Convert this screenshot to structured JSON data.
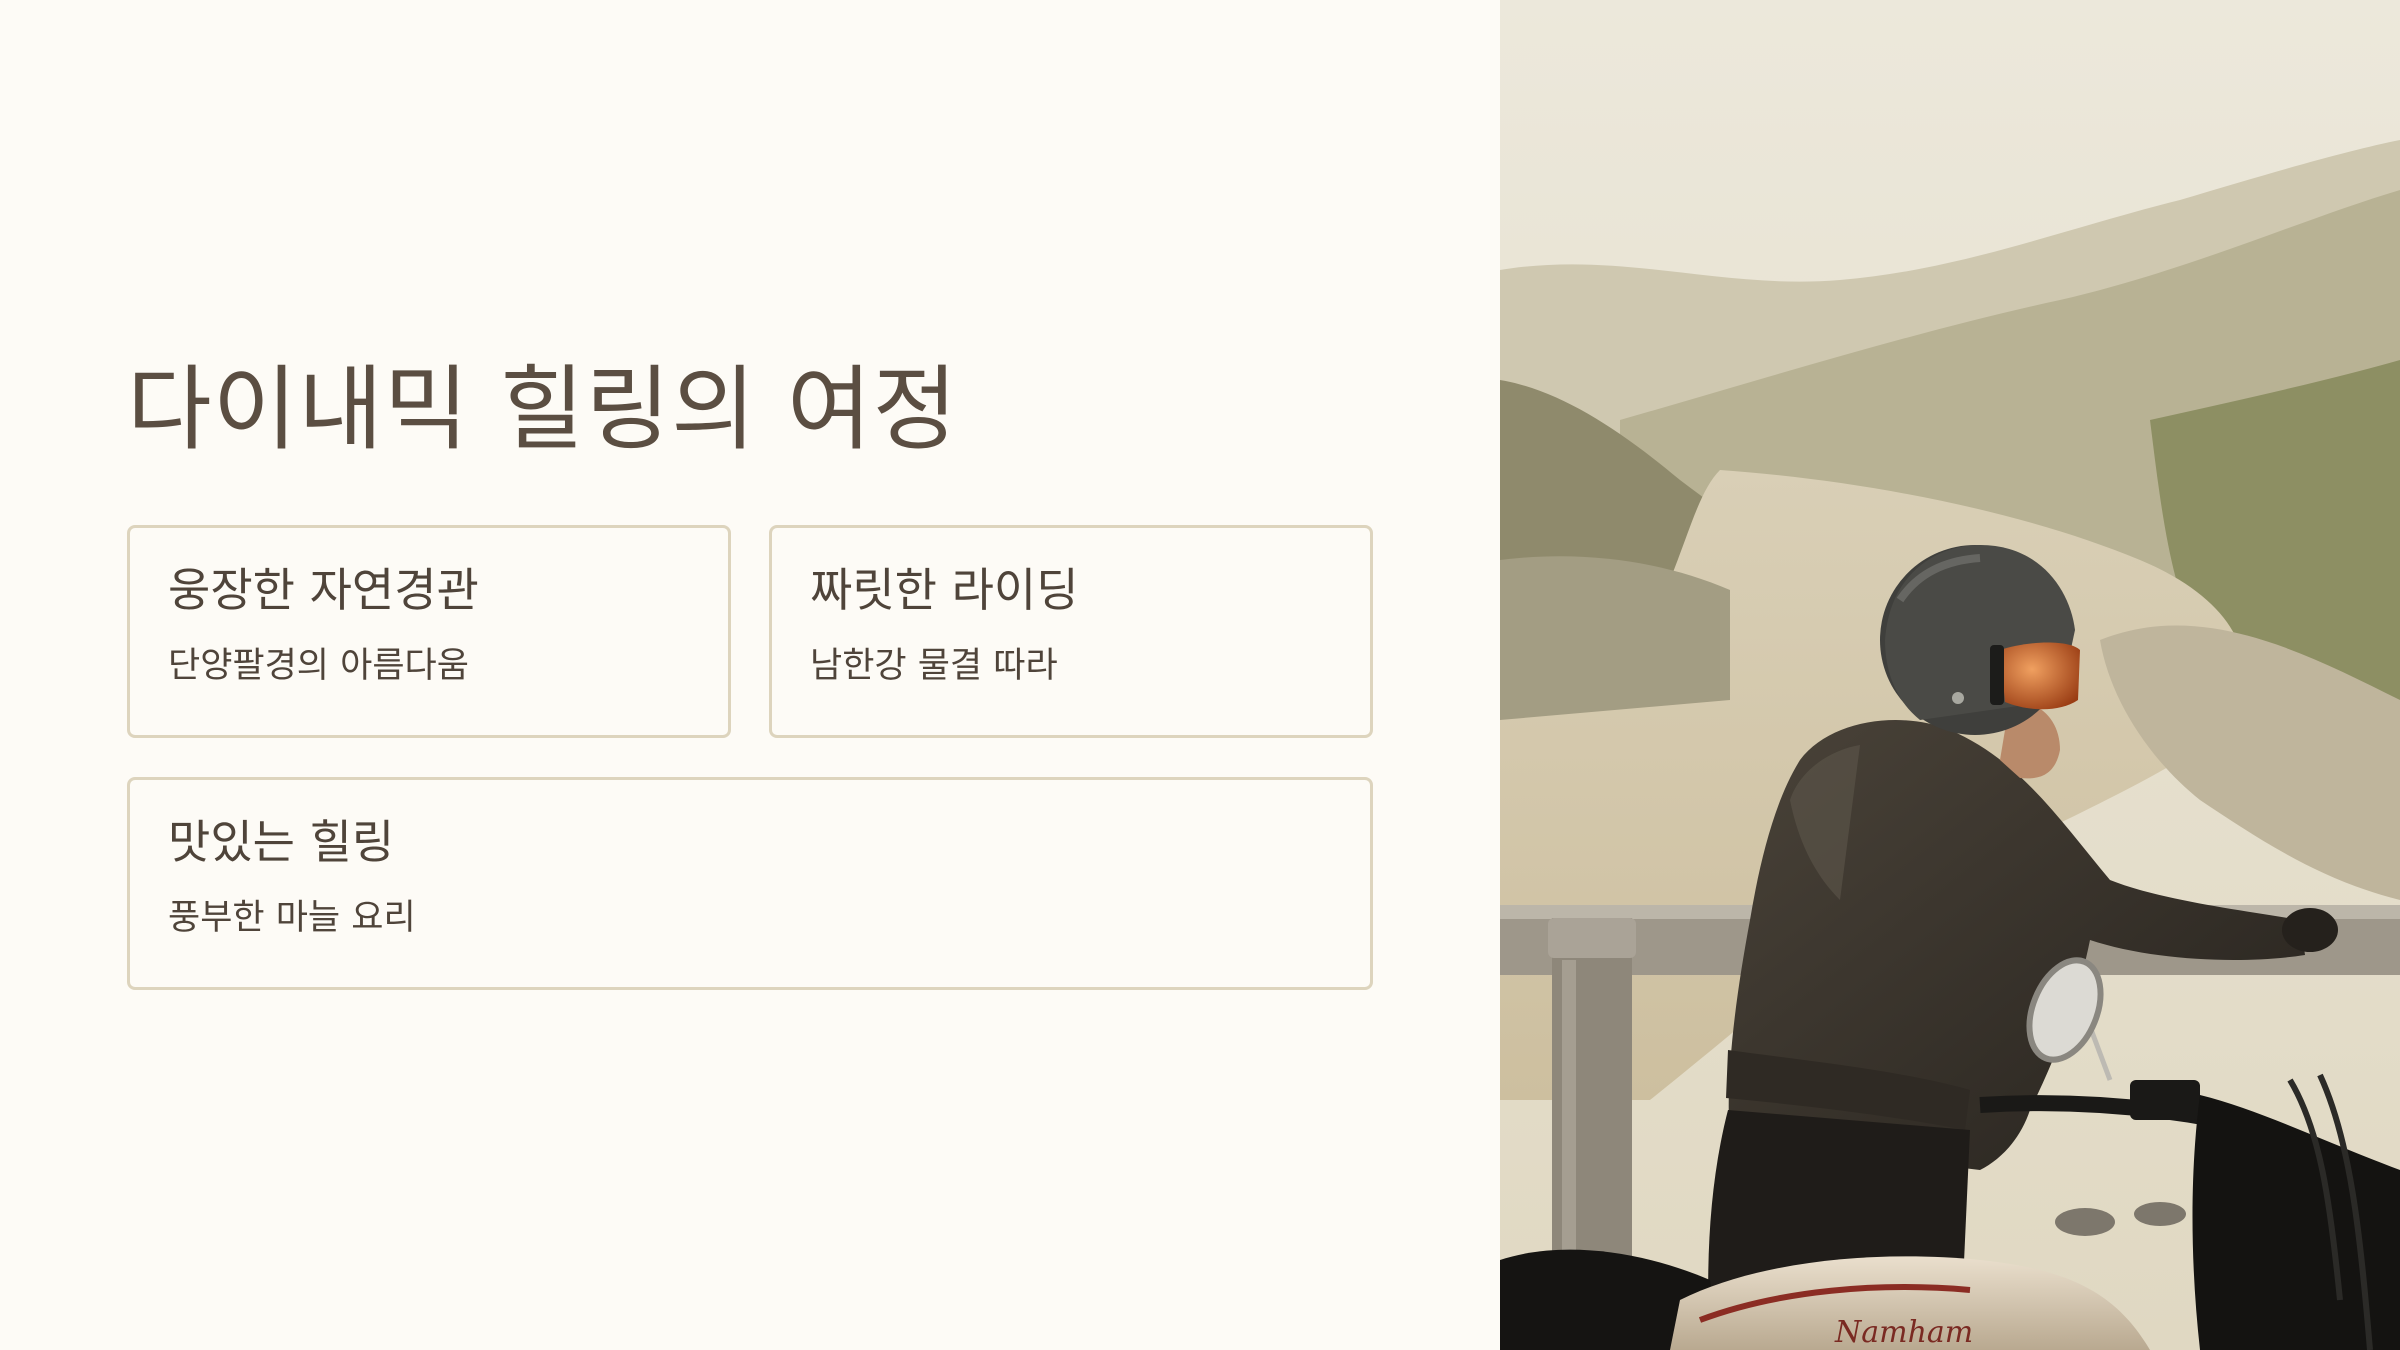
{
  "title": "다이내믹 힐링의 여정",
  "cards": [
    {
      "title": "웅장한 자연경관",
      "desc": "단양팔경의 아름다움"
    },
    {
      "title": "짜릿한 라이딩",
      "desc": "남한강 물결 따라"
    },
    {
      "title": "맛있는 힐링",
      "desc": "풍부한 마늘 요리"
    }
  ],
  "photo": {
    "motorcycle_brand": "Namham"
  },
  "colors": {
    "background": "#fdfbf6",
    "text": "#5b4e42",
    "card_border": "#ddd4bd"
  }
}
